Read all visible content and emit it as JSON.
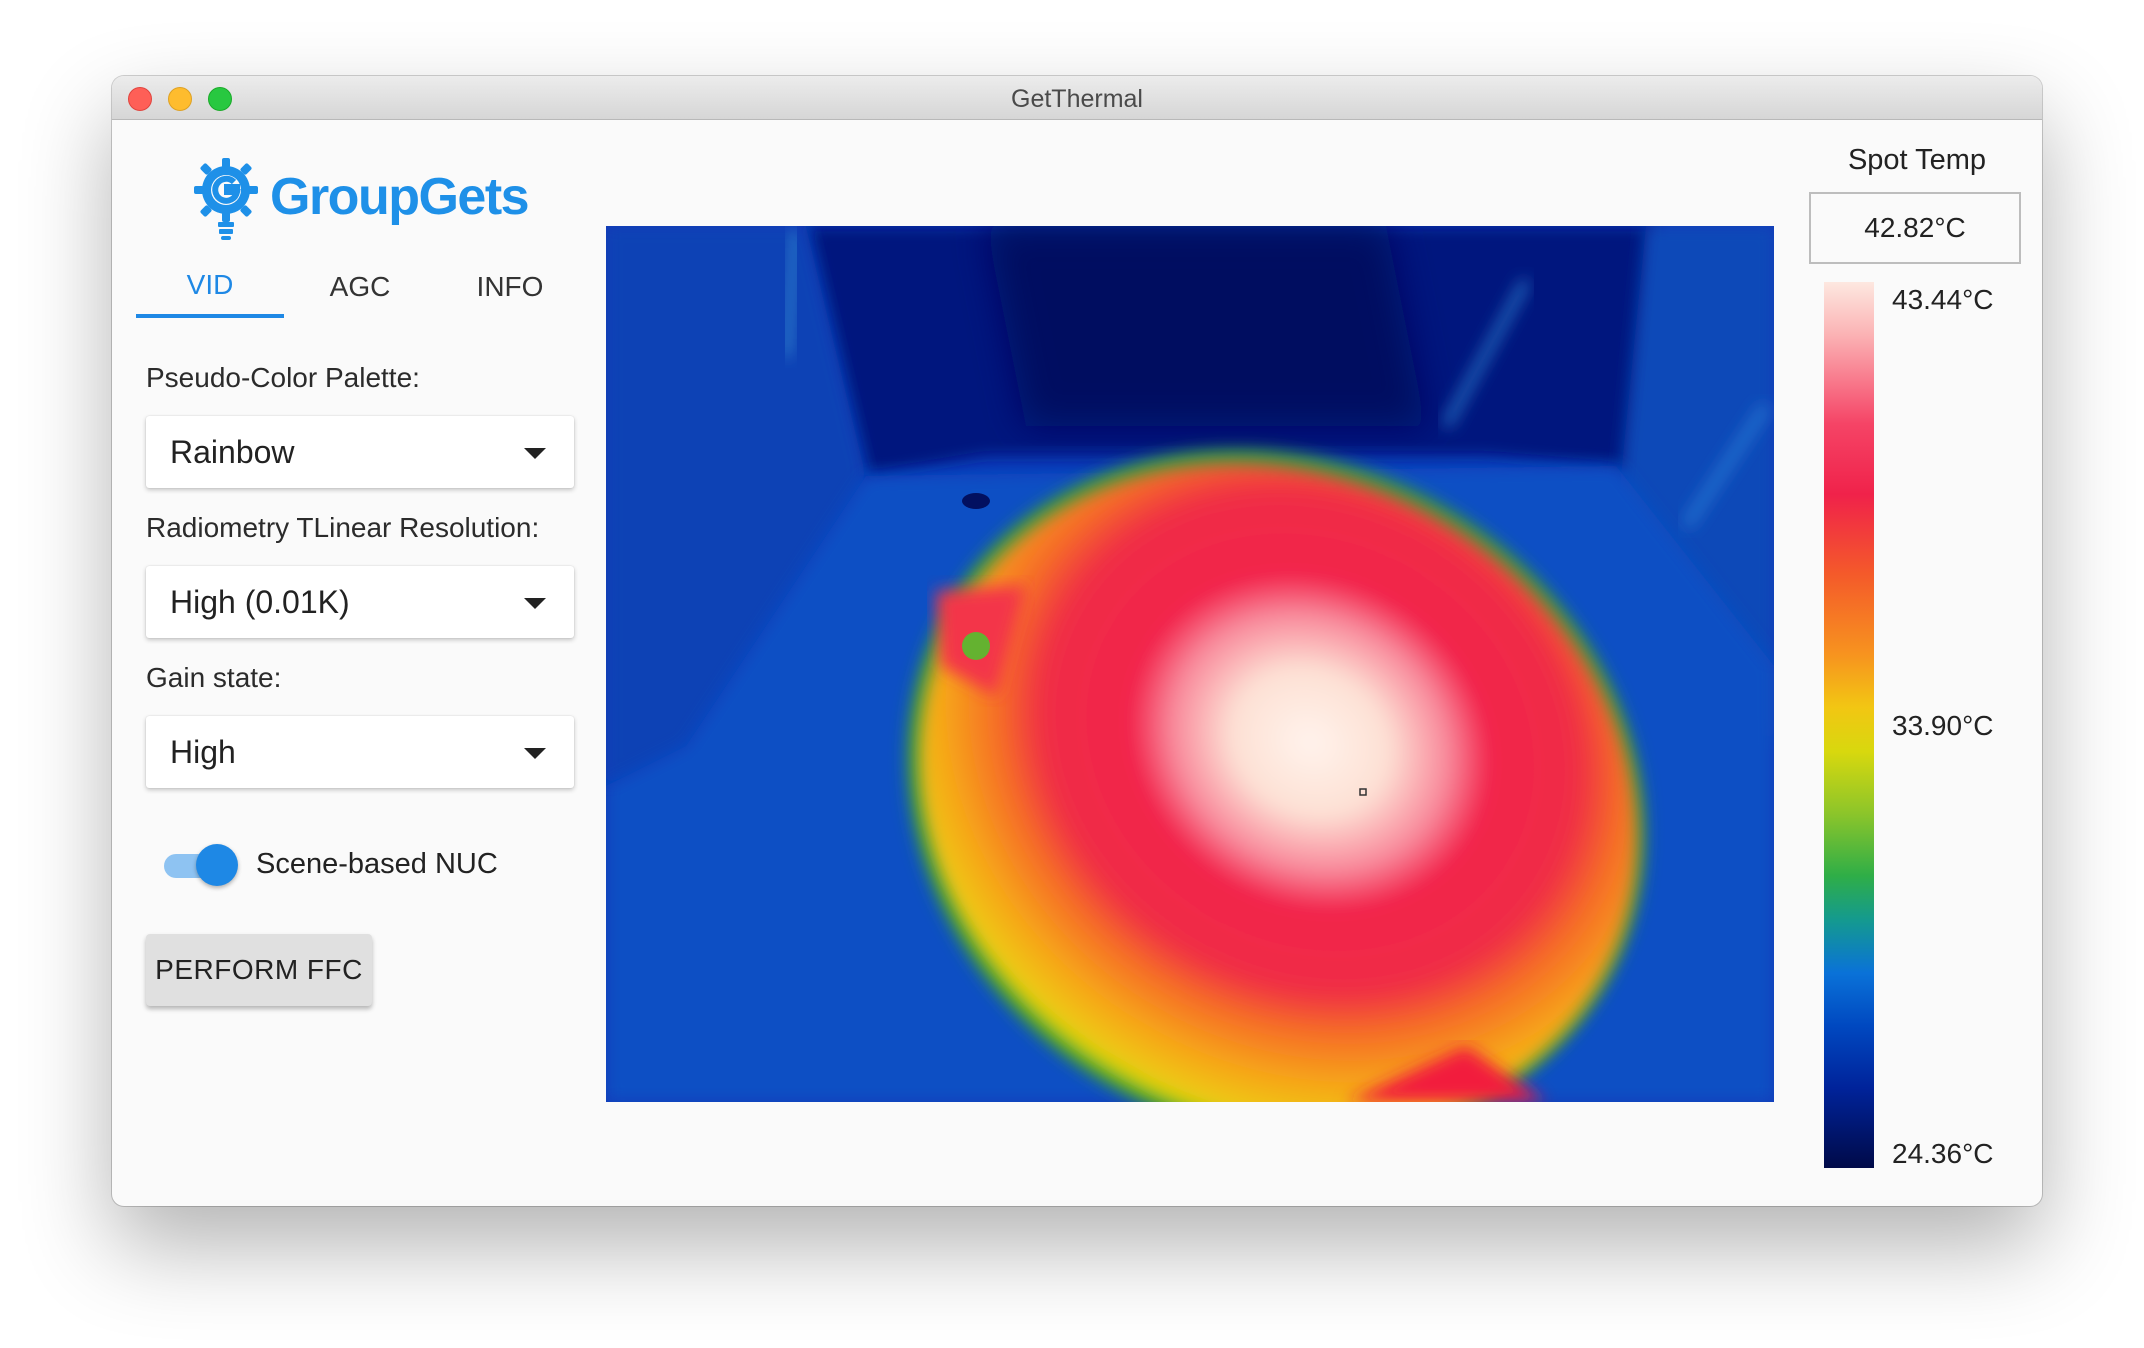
{
  "window": {
    "title": "GetThermal"
  },
  "logo": {
    "text": "GroupGets"
  },
  "tabs": [
    {
      "label": "VID",
      "active": true
    },
    {
      "label": "AGC",
      "active": false
    },
    {
      "label": "INFO",
      "active": false
    }
  ],
  "controls": {
    "palette_label": "Pseudo-Color Palette:",
    "palette_value": "Rainbow",
    "resolution_label": "Radiometry TLinear Resolution:",
    "resolution_value": "High (0.01K)",
    "gain_label": "Gain state:",
    "gain_value": "High",
    "nuc_label": "Scene-based NUC",
    "nuc_enabled": true,
    "ffc_button": "PERFORM FFC"
  },
  "spot": {
    "label": "Spot Temp",
    "value": "42.82°C"
  },
  "colorbar": {
    "max": "43.44°C",
    "mid": "33.90°C",
    "min": "24.36°C"
  },
  "colors": {
    "accent": "#1e88e5",
    "logo": "#1e90e8"
  }
}
